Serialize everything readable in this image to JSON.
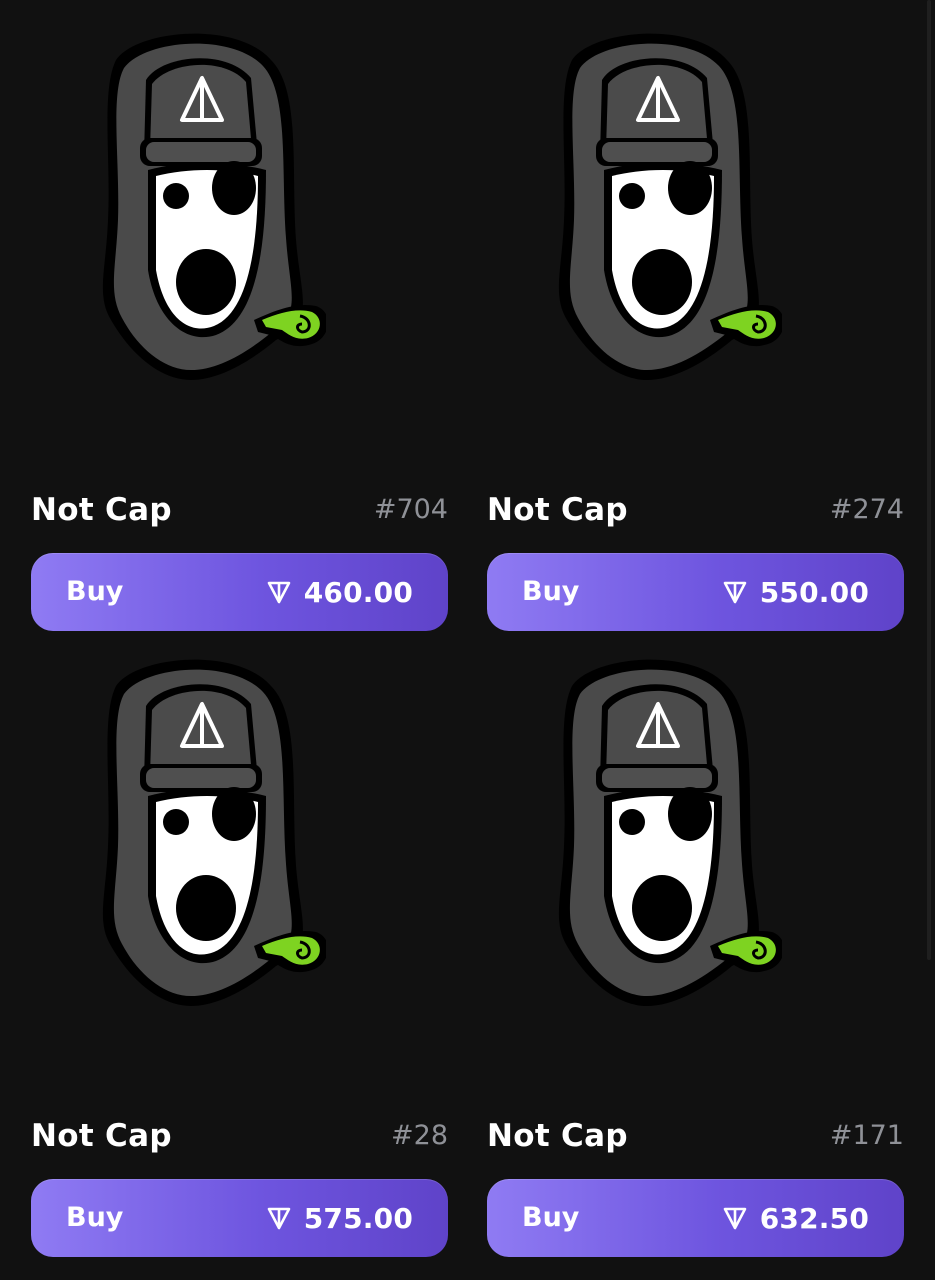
{
  "theme": {
    "background": "#111111",
    "button_gradient_start": "#8f7bf3",
    "button_gradient_end": "#5f43c9",
    "number_color": "#8f9197",
    "accent_green": "#7ed321"
  },
  "items": [
    {
      "name": "Not Cap",
      "number": "#704",
      "buy_label": "Buy",
      "currency_icon": "ton-icon",
      "price": "460.00"
    },
    {
      "name": "Not Cap",
      "number": "#274",
      "buy_label": "Buy",
      "currency_icon": "ton-icon",
      "price": "550.00"
    },
    {
      "name": "Not Cap",
      "number": "#28",
      "buy_label": "Buy",
      "currency_icon": "ton-icon",
      "price": "575.00"
    },
    {
      "name": "Not Cap",
      "number": "#171",
      "buy_label": "Buy",
      "currency_icon": "ton-icon",
      "price": "632.50"
    }
  ]
}
